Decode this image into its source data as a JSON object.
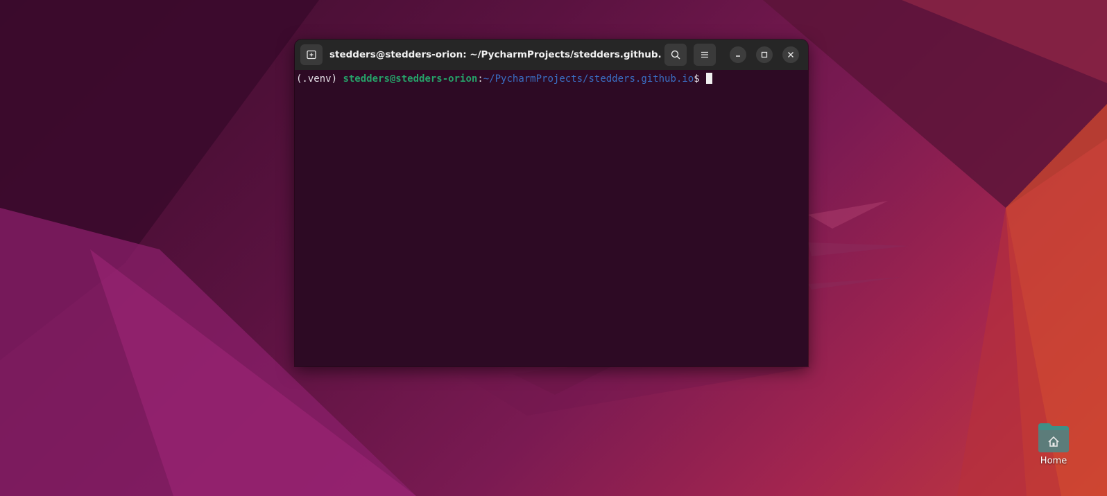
{
  "desktop": {
    "home_icon": {
      "icon": "folder-home-icon",
      "label": "Home"
    }
  },
  "terminal": {
    "title": "stedders@stedders-orion: ~/PycharmProjects/stedders.github.io",
    "buttons": {
      "new_tab": "new-tab-icon",
      "search": "search-icon",
      "menu": "hamburger-menu-icon",
      "minimize": "minimize-icon",
      "maximize": "maximize-icon",
      "close": "close-icon"
    },
    "prompt": {
      "venv": "(.venv) ",
      "user_host": "stedders@stedders-orion",
      "colon": ":",
      "path": "~/PycharmProjects/stedders.github.io",
      "dollar": "$ "
    }
  },
  "colors": {
    "terminal_bg": "#2d0a24",
    "titlebar_bg": "#262626",
    "prompt_user": "#26a269",
    "prompt_path": "#3a6fc4"
  }
}
